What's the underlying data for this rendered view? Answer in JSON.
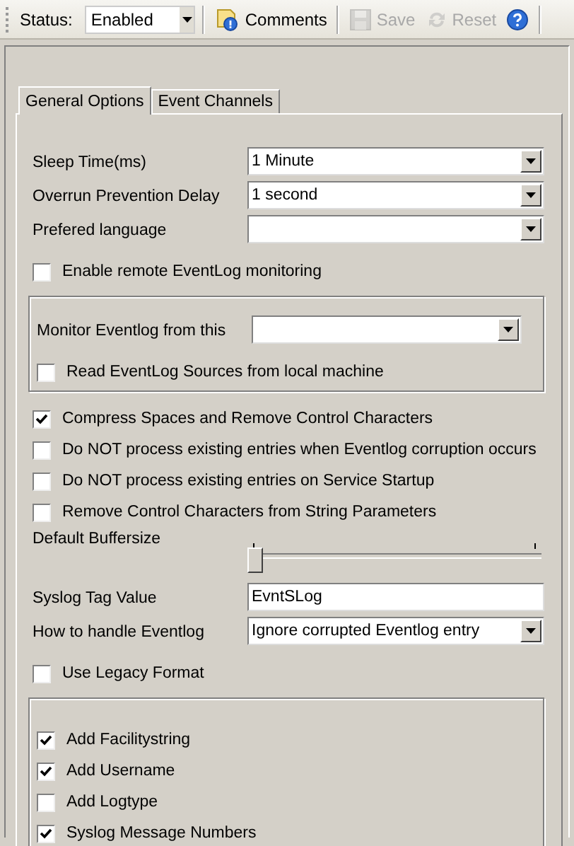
{
  "toolbar": {
    "status_label": "Status:",
    "status_value": "Enabled",
    "buttons": [
      {
        "label": "Comments",
        "kind": "comments",
        "disabled": false
      },
      {
        "label": "Save",
        "kind": "save",
        "disabled": true
      },
      {
        "label": "Reset",
        "kind": "reset",
        "disabled": true
      },
      {
        "kind": "help",
        "disabled": false
      }
    ]
  },
  "tabs": [
    {
      "label": "General Options",
      "selected": true
    },
    {
      "label": "Event Channels",
      "selected": false
    }
  ],
  "fields": [
    {
      "kind": "combo",
      "label": "Sleep Time(ms)",
      "value": "1 Minute"
    },
    {
      "kind": "combo",
      "label": "Overrun Prevention Delay",
      "value": "1 second"
    },
    {
      "kind": "combo",
      "label": "Prefered language"
    },
    {
      "kind": "checkbox",
      "label": "Enable remote EventLog monitoring",
      "checked": false
    },
    {
      "kind": "group",
      "items": [
        {
          "kind": "combo",
          "label": "Monitor Eventlog from this"
        },
        {
          "kind": "checkbox",
          "label": "Read EventLog Sources from local machine",
          "checked": false
        }
      ]
    },
    {
      "kind": "checkbox",
      "label": "Compress Spaces and Remove Control Characters",
      "checked": true
    },
    {
      "kind": "checkbox",
      "label": "Do NOT process existing entries when Eventlog corruption occurs",
      "checked": false
    },
    {
      "kind": "checkbox",
      "label": "Do NOT process existing entries on Service Startup",
      "checked": false
    },
    {
      "kind": "checkbox",
      "label": "Remove Control Characters from String Parameters",
      "checked": false
    },
    {
      "kind": "slider",
      "label": "Default Buffersize",
      "level": 0
    },
    {
      "kind": "text",
      "label": "Syslog Tag Value",
      "value": "EvntSLog"
    },
    {
      "kind": "combo",
      "label": "How to handle Eventlog",
      "value": "Ignore corrupted Eventlog entry"
    },
    {
      "kind": "checkbox",
      "label": "Use Legacy Format",
      "checked": false
    },
    {
      "kind": "group",
      "items": [
        {
          "kind": "checkbox",
          "label": "Add Facilitystring",
          "checked": true
        },
        {
          "kind": "checkbox",
          "label": "Add Username",
          "checked": true
        },
        {
          "kind": "checkbox",
          "label": "Add Logtype",
          "checked": false
        },
        {
          "kind": "checkbox",
          "label": "Syslog Message Numbers",
          "checked": true
        }
      ]
    }
  ]
}
